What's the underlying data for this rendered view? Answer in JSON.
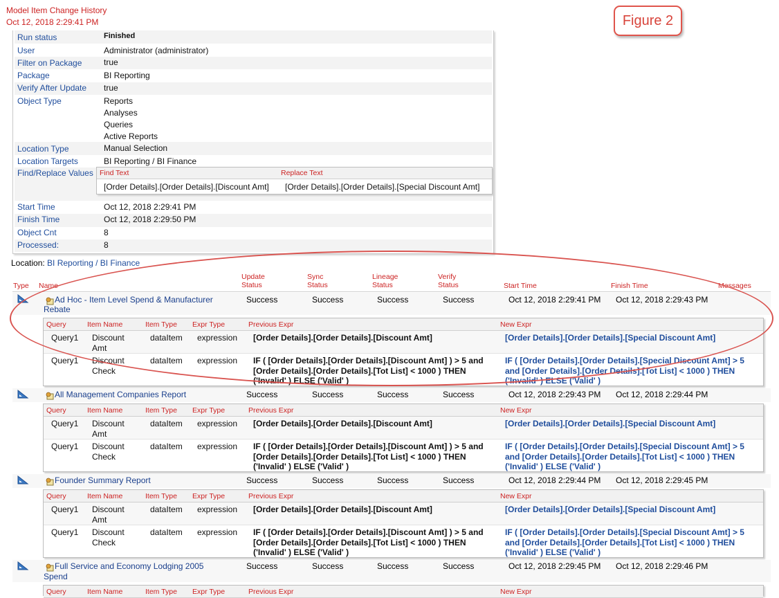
{
  "header": {
    "title": "Model Item Change History",
    "timestamp": "Oct 12, 2018 2:29:41 PM"
  },
  "figure_label": "Figure 2",
  "summary": [
    {
      "key": "Run status",
      "value": "Finished",
      "bold": true
    },
    {
      "key": "User",
      "value": "Administrator (administrator)"
    },
    {
      "key": "Filter on Package",
      "value": "true"
    },
    {
      "key": "Package",
      "value": "BI Reporting"
    },
    {
      "key": "Verify After Update",
      "value": "true"
    },
    {
      "key": "Object Type",
      "values": [
        "Reports",
        "Analyses",
        "Queries",
        "Active Reports"
      ]
    },
    {
      "key": "Location Type",
      "value": "Manual Selection"
    },
    {
      "key": "Location Targets",
      "value": "BI Reporting / BI Finance"
    },
    {
      "key": "Find/Replace Values"
    },
    {
      "key": "Start Time",
      "value": "Oct 12, 2018 2:29:41 PM"
    },
    {
      "key": "Finish Time",
      "value": "Oct 12, 2018 2:29:50 PM"
    },
    {
      "key": "Object Cnt",
      "value": "8"
    },
    {
      "key": "Processed:",
      "value": "8"
    }
  ],
  "find_replace": {
    "headers": [
      "Find Text",
      "Replace Text"
    ],
    "find": "[Order Details].[Order Details].[Discount Amt]",
    "replace": "[Order Details].[Order Details].[Special Discount Amt]"
  },
  "location": {
    "label": "Location:",
    "path": "BI Reporting / BI Finance"
  },
  "columns": {
    "type": "Type",
    "name": "Name",
    "update": [
      "Update",
      "Status"
    ],
    "sync": [
      "Sync",
      "Status"
    ],
    "lineage": [
      "Lineage",
      "Status"
    ],
    "verify": [
      "Verify",
      "Status"
    ],
    "start": "Start Time",
    "finish": "Finish Time",
    "messages": "Messages"
  },
  "sub_columns": [
    "Query",
    "Item Name",
    "Item Type",
    "Expr Type",
    "Previous Expr",
    "New Expr"
  ],
  "items": [
    {
      "name": [
        "Ad Hoc - Item Level Spend & Manufacturer",
        "Rebate"
      ],
      "update": "Success",
      "sync": "Success",
      "lineage": "Success",
      "verify": "Success",
      "start": "Oct 12, 2018 2:29:41 PM",
      "finish": "Oct 12, 2018 2:29:43 PM"
    },
    {
      "name": [
        "All Management Companies Report"
      ],
      "update": "Success",
      "sync": "Success",
      "lineage": "Success",
      "verify": "Success",
      "start": "Oct 12, 2018 2:29:43 PM",
      "finish": "Oct 12, 2018 2:29:44 PM"
    },
    {
      "name": [
        "Founder Summary Report"
      ],
      "update": "Success",
      "sync": "Success",
      "lineage": "Success",
      "verify": "Success",
      "start": "Oct 12, 2018 2:29:44 PM",
      "finish": "Oct 12, 2018 2:29:45 PM"
    },
    {
      "name": [
        "Full Service and Economy Lodging 2005",
        "Spend"
      ],
      "update": "Success",
      "sync": "Success",
      "lineage": "Success",
      "verify": "Success",
      "start": "Oct 12, 2018 2:29:45 PM",
      "finish": "Oct 12, 2018 2:29:46 PM"
    }
  ],
  "changes": [
    {
      "query": "Query1",
      "item": [
        "Discount",
        "Amt"
      ],
      "type": "dataItem",
      "expr_type": "expression",
      "prev": [
        "[Order Details].[Order Details].[Discount Amt]"
      ],
      "new": [
        "[Order Details].[Order Details].[Special Discount Amt]"
      ]
    },
    {
      "query": "Query1",
      "item": [
        "Discount",
        "Check"
      ],
      "type": "dataItem",
      "expr_type": "expression",
      "prev": [
        "IF ( [Order Details].[Order Details].[Discount Amt] ) > 5 and",
        "[Order Details].[Order Details].[Tot List] < 1000 ) THEN",
        "('Invalid' ) ELSE ('Valid' )"
      ],
      "new": [
        "IF ( [Order Details].[Order Details].[Special Discount Amt] > 5",
        "and [Order Details].[Order Details].[Tot List] < 1000 ) THEN",
        "('Invalid' ) ELSE ('Valid' )"
      ]
    }
  ]
}
